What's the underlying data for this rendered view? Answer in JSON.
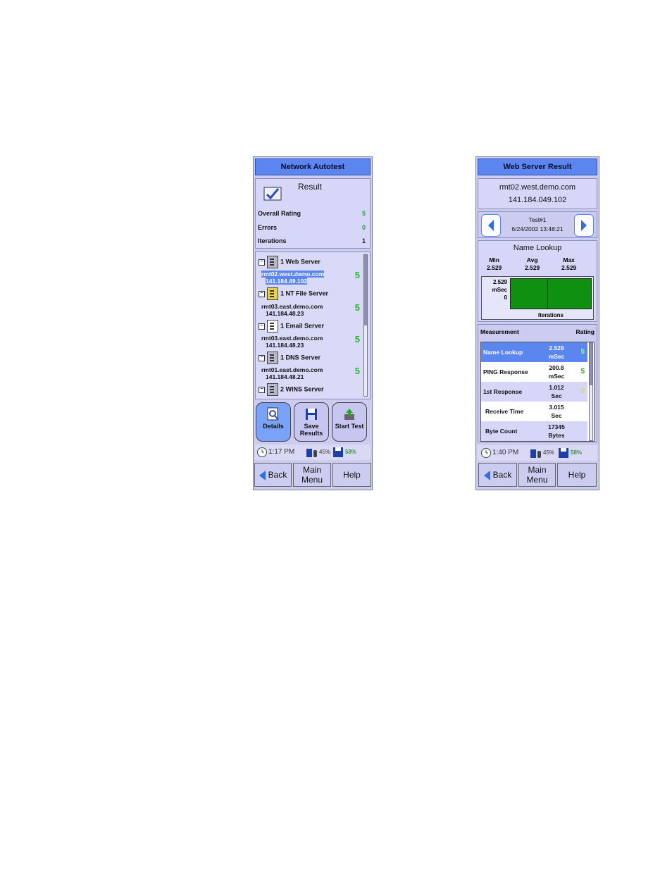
{
  "left": {
    "title": "Network Autotest",
    "result_label": "Result",
    "summary": [
      {
        "label": "Overall Rating",
        "value": "5"
      },
      {
        "label": "Errors",
        "value": "0"
      },
      {
        "label": "Iterations",
        "value": "1"
      }
    ],
    "tree": [
      {
        "category": "1 Web Server",
        "host": "rmt02.west.demo.com",
        "ip": "141.184.49.102",
        "rating": "5",
        "selected": true
      },
      {
        "category": "1 NT File Server",
        "host": "rmt03.east.demo.com",
        "ip": "141.184.48.23",
        "rating": "5"
      },
      {
        "category": "1 Email Server",
        "host": "rmt03.east.demo.com",
        "ip": "141.184.48.23",
        "rating": "5"
      },
      {
        "category": "1 DNS Server",
        "host": "rmt01.east.demo.com",
        "ip": "141.184.48.21",
        "rating": "5"
      },
      {
        "category": "2 WINS Server"
      }
    ],
    "buttons": {
      "details": "Details",
      "save": "Save Results",
      "start": "Start Test"
    },
    "status": {
      "time": "1:17 PM",
      "battery": "45%",
      "storage": "58%"
    },
    "bottom": {
      "back": "Back",
      "main": "Main Menu",
      "help": "Help"
    }
  },
  "right": {
    "title": "Web Server Result",
    "host": "rmt02.west.demo.com",
    "ip": "141.184.049.102",
    "test": "Test#1",
    "datetime": "6/24/2002 13:48:21",
    "chart_title": "Name Lookup",
    "stats": [
      {
        "label": "Min",
        "value": "2.529"
      },
      {
        "label": "Avg",
        "value": "2.529"
      },
      {
        "label": "Max",
        "value": "2.529"
      }
    ],
    "chart_ymax": "2.529",
    "chart_unit": "mSec",
    "chart_ymin": "0",
    "chart_xlabel": "Iterations",
    "table_header": {
      "measurement": "Measurement",
      "rating": "Rating"
    },
    "measurements": [
      {
        "name": "Name Lookup",
        "value": "2.529",
        "unit": "mSec",
        "rating": "5",
        "selected": true
      },
      {
        "name": "PING Response",
        "value": "200.8",
        "unit": "mSec",
        "rating": "5"
      },
      {
        "name": "1st Response",
        "value": "1.012",
        "unit": "Sec",
        "rating": "5"
      },
      {
        "name": "Receive Time",
        "value": "3.015",
        "unit": "Sec",
        "rating": ""
      },
      {
        "name": "Byte Count",
        "value": "17345",
        "unit": "Bytes",
        "rating": ""
      }
    ],
    "status": {
      "time": "1:40 PM",
      "battery": "45%",
      "storage": "58%"
    },
    "bottom": {
      "back": "Back",
      "main": "Main Menu",
      "help": "Help"
    }
  },
  "colors": {
    "title_bar": "#5b86f0",
    "screen_bg": "#ccccf0",
    "rating_green": "#22aa22",
    "chart_fill": "#109010"
  }
}
